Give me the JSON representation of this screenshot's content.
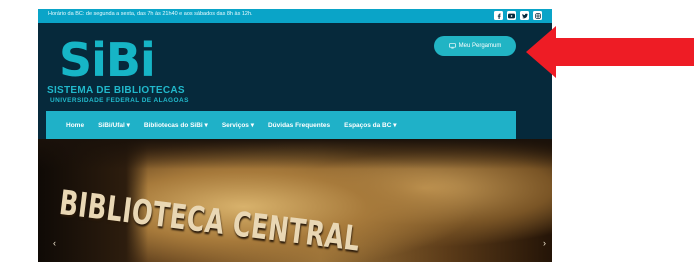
{
  "topbar": {
    "hours": "Horário da BC: de segunda a sexta, das 7h às 21h40 e aos sábados das 8h às 12h.",
    "social_icons": [
      "facebook-icon",
      "youtube-icon",
      "twitter-icon",
      "instagram-icon"
    ]
  },
  "logo": {
    "mark": "SiBi",
    "title": "SISTEMA DE BIBLIOTECAS",
    "subtitle": "UNIVERSIDADE FEDERAL DE ALAGOAS"
  },
  "header": {
    "pergamum_label": "Meu Pergamum"
  },
  "nav": {
    "items": [
      {
        "label": "Home"
      },
      {
        "label": "SiBi/Ufal ▾"
      },
      {
        "label": "Bibliotecas do SiBi ▾"
      },
      {
        "label": "Serviços ▾"
      },
      {
        "label": "Dúvidas Frequentes"
      },
      {
        "label": "Espaços da BC ▾"
      }
    ]
  },
  "hero": {
    "sign_text": "BIBLIOTECA CENTRAL",
    "prev": "‹",
    "next": "›"
  },
  "colors": {
    "topbar": "#0aa4c8",
    "header": "#06293b",
    "nav": "#1fb1c8",
    "accent": "#21b4c4",
    "annotation_arrow": "#ee1c25"
  }
}
